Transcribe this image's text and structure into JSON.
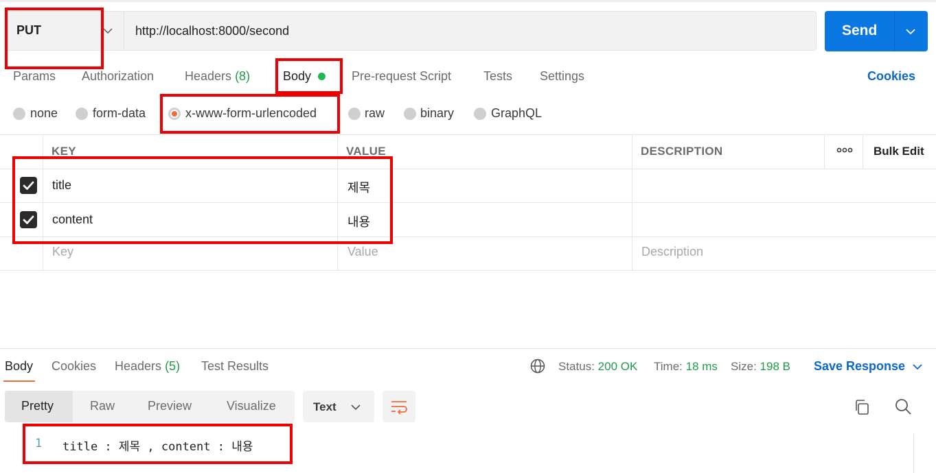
{
  "request": {
    "method": "PUT",
    "url": "http://localhost:8000/second",
    "send_label": "Send"
  },
  "request_tabs": {
    "params": "Params",
    "authorization": "Authorization",
    "headers": "Headers",
    "headers_count": "(8)",
    "body": "Body",
    "pre_request": "Pre-request Script",
    "tests": "Tests",
    "settings": "Settings",
    "cookies": "Cookies"
  },
  "body_types": {
    "none": "none",
    "form_data": "form-data",
    "urlencoded": "x-www-form-urlencoded",
    "raw": "raw",
    "binary": "binary",
    "graphql": "GraphQL",
    "selected": "x-www-form-urlencoded"
  },
  "params_table": {
    "headers": {
      "key": "KEY",
      "value": "VALUE",
      "description": "DESCRIPTION",
      "bulk_edit": "Bulk Edit"
    },
    "rows": [
      {
        "checked": true,
        "key": "title",
        "value": "제목",
        "description": ""
      },
      {
        "checked": true,
        "key": "content",
        "value": "내용",
        "description": ""
      }
    ],
    "placeholder": {
      "key": "Key",
      "value": "Value",
      "description": "Description"
    }
  },
  "response_tabs": {
    "body": "Body",
    "cookies": "Cookies",
    "headers": "Headers",
    "headers_count": "(5)",
    "test_results": "Test Results"
  },
  "response_status": {
    "status_label": "Status:",
    "status_value": "200 OK",
    "time_label": "Time:",
    "time_value": "18 ms",
    "size_label": "Size:",
    "size_value": "198 B",
    "save_response": "Save Response"
  },
  "view_modes": {
    "pretty": "Pretty",
    "raw": "Raw",
    "preview": "Preview",
    "visualize": "Visualize",
    "format": "Text"
  },
  "response_body": {
    "line_number": "1",
    "line_text": "title : 제목 , content : 내용"
  },
  "colors": {
    "accent_blue": "#0b77e3",
    "status_green": "#1f9b4b",
    "selected_orange": "#f26b3a",
    "annotation_red": "#ee0000"
  }
}
